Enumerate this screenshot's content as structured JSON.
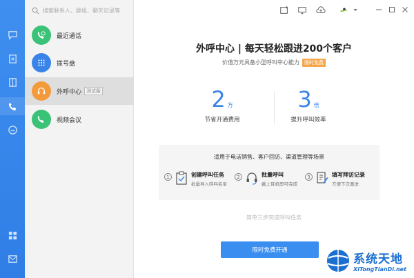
{
  "search": {
    "placeholder": "搜索联系人、群组、聊天记录等"
  },
  "rail": {
    "items": [
      {
        "name": "chat-icon"
      },
      {
        "name": "contacts-icon"
      },
      {
        "name": "documents-icon"
      },
      {
        "name": "phone-icon"
      },
      {
        "name": "cloud-icon"
      },
      {
        "name": "apps-icon"
      },
      {
        "name": "mail-icon"
      }
    ],
    "accent": "#3f8ff0"
  },
  "list": {
    "items": [
      {
        "label": "最近通话",
        "icon": "phone-history-icon",
        "color": "#3ac276"
      },
      {
        "label": "拨号盘",
        "icon": "dialpad-icon",
        "color": "#3a84e8"
      },
      {
        "label": "外呼中心",
        "icon": "headset-icon",
        "color": "#f39a3b",
        "tag": "测试版"
      },
      {
        "label": "视频会议",
        "icon": "video-call-icon",
        "color": "#3ac276"
      }
    ]
  },
  "main": {
    "title": "外呼中心 | 每天轻松跟进200个客户",
    "subtitle": "价值万元具备小型呼叫中心能力",
    "badge": "限时免费",
    "stats": [
      {
        "num": "2",
        "unit": "万",
        "label": "节省开通费用"
      },
      {
        "num": "3",
        "unit": "倍",
        "label": "提升呼叫效率"
      }
    ],
    "scenario_title": "适用于电话销售、客户回访、渠道管理等场景",
    "steps": [
      {
        "num": "1",
        "title": "创建呼叫任务",
        "desc": "批量导入呼叫名单"
      },
      {
        "num": "2",
        "title": "批量呼叫",
        "desc": "戴上耳机即可完成"
      },
      {
        "num": "3",
        "title": "填写拜访记录",
        "desc": "方便下次邀进"
      }
    ],
    "faded_text": "简单三步完成呼叫任务",
    "cta": "限时免费开通"
  },
  "watermark": {
    "cn": "系统天地",
    "en": "XiTongTianDi.net"
  }
}
